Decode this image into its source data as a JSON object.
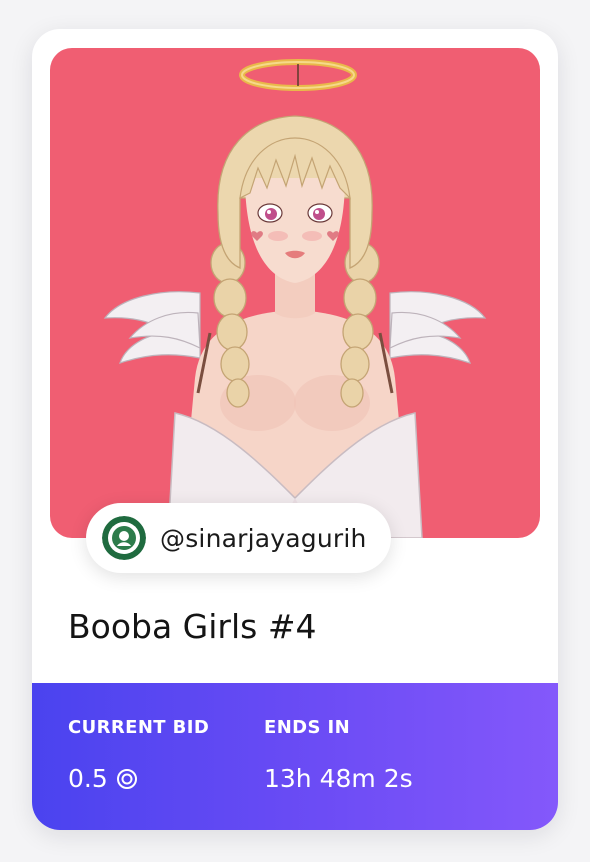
{
  "card": {
    "artwork": {
      "alt": "Booba Girls #4 artwork",
      "background_color": "#f05e72"
    },
    "creator": {
      "handle": "@sinarjayagurih",
      "avatar_icon": "sinarjaya-logo-icon"
    },
    "title": "Booba Girls #4",
    "auction": {
      "current_bid_label": "CURRENT BID",
      "current_bid_value": "0.5",
      "currency_icon": "coin-icon",
      "ends_in_label": "ENDS IN",
      "ends_in_value": "13h 48m 2s",
      "gradient_start": "#4a43ef",
      "gradient_end": "#8458fb"
    }
  }
}
